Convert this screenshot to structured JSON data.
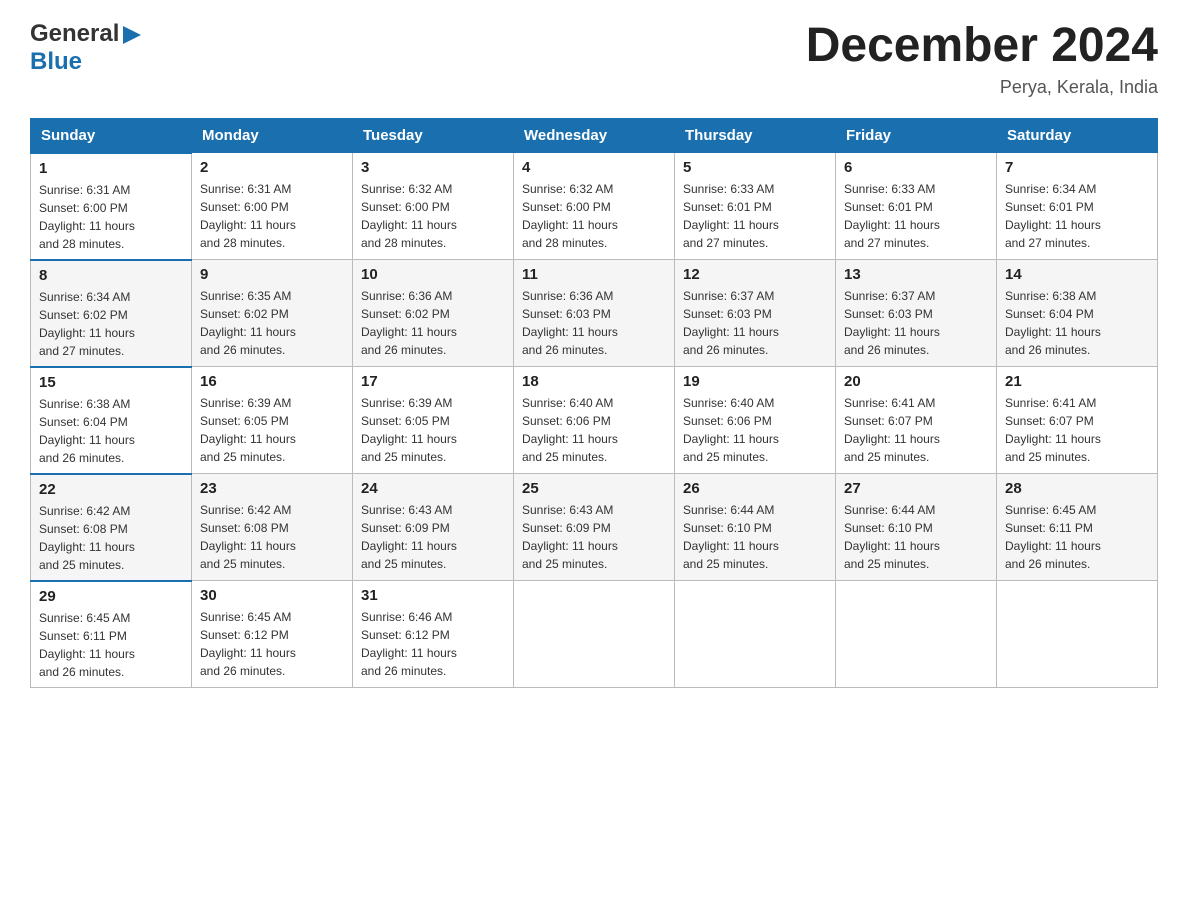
{
  "header": {
    "logo_line1": "General",
    "logo_line2": "Blue",
    "title": "December 2024",
    "subtitle": "Perya, Kerala, India"
  },
  "days_of_week": [
    "Sunday",
    "Monday",
    "Tuesday",
    "Wednesday",
    "Thursday",
    "Friday",
    "Saturday"
  ],
  "weeks": [
    [
      {
        "num": "1",
        "sunrise": "6:31 AM",
        "sunset": "6:00 PM",
        "daylight": "11 hours and 28 minutes."
      },
      {
        "num": "2",
        "sunrise": "6:31 AM",
        "sunset": "6:00 PM",
        "daylight": "11 hours and 28 minutes."
      },
      {
        "num": "3",
        "sunrise": "6:32 AM",
        "sunset": "6:00 PM",
        "daylight": "11 hours and 28 minutes."
      },
      {
        "num": "4",
        "sunrise": "6:32 AM",
        "sunset": "6:00 PM",
        "daylight": "11 hours and 28 minutes."
      },
      {
        "num": "5",
        "sunrise": "6:33 AM",
        "sunset": "6:01 PM",
        "daylight": "11 hours and 27 minutes."
      },
      {
        "num": "6",
        "sunrise": "6:33 AM",
        "sunset": "6:01 PM",
        "daylight": "11 hours and 27 minutes."
      },
      {
        "num": "7",
        "sunrise": "6:34 AM",
        "sunset": "6:01 PM",
        "daylight": "11 hours and 27 minutes."
      }
    ],
    [
      {
        "num": "8",
        "sunrise": "6:34 AM",
        "sunset": "6:02 PM",
        "daylight": "11 hours and 27 minutes."
      },
      {
        "num": "9",
        "sunrise": "6:35 AM",
        "sunset": "6:02 PM",
        "daylight": "11 hours and 26 minutes."
      },
      {
        "num": "10",
        "sunrise": "6:36 AM",
        "sunset": "6:02 PM",
        "daylight": "11 hours and 26 minutes."
      },
      {
        "num": "11",
        "sunrise": "6:36 AM",
        "sunset": "6:03 PM",
        "daylight": "11 hours and 26 minutes."
      },
      {
        "num": "12",
        "sunrise": "6:37 AM",
        "sunset": "6:03 PM",
        "daylight": "11 hours and 26 minutes."
      },
      {
        "num": "13",
        "sunrise": "6:37 AM",
        "sunset": "6:03 PM",
        "daylight": "11 hours and 26 minutes."
      },
      {
        "num": "14",
        "sunrise": "6:38 AM",
        "sunset": "6:04 PM",
        "daylight": "11 hours and 26 minutes."
      }
    ],
    [
      {
        "num": "15",
        "sunrise": "6:38 AM",
        "sunset": "6:04 PM",
        "daylight": "11 hours and 26 minutes."
      },
      {
        "num": "16",
        "sunrise": "6:39 AM",
        "sunset": "6:05 PM",
        "daylight": "11 hours and 25 minutes."
      },
      {
        "num": "17",
        "sunrise": "6:39 AM",
        "sunset": "6:05 PM",
        "daylight": "11 hours and 25 minutes."
      },
      {
        "num": "18",
        "sunrise": "6:40 AM",
        "sunset": "6:06 PM",
        "daylight": "11 hours and 25 minutes."
      },
      {
        "num": "19",
        "sunrise": "6:40 AM",
        "sunset": "6:06 PM",
        "daylight": "11 hours and 25 minutes."
      },
      {
        "num": "20",
        "sunrise": "6:41 AM",
        "sunset": "6:07 PM",
        "daylight": "11 hours and 25 minutes."
      },
      {
        "num": "21",
        "sunrise": "6:41 AM",
        "sunset": "6:07 PM",
        "daylight": "11 hours and 25 minutes."
      }
    ],
    [
      {
        "num": "22",
        "sunrise": "6:42 AM",
        "sunset": "6:08 PM",
        "daylight": "11 hours and 25 minutes."
      },
      {
        "num": "23",
        "sunrise": "6:42 AM",
        "sunset": "6:08 PM",
        "daylight": "11 hours and 25 minutes."
      },
      {
        "num": "24",
        "sunrise": "6:43 AM",
        "sunset": "6:09 PM",
        "daylight": "11 hours and 25 minutes."
      },
      {
        "num": "25",
        "sunrise": "6:43 AM",
        "sunset": "6:09 PM",
        "daylight": "11 hours and 25 minutes."
      },
      {
        "num": "26",
        "sunrise": "6:44 AM",
        "sunset": "6:10 PM",
        "daylight": "11 hours and 25 minutes."
      },
      {
        "num": "27",
        "sunrise": "6:44 AM",
        "sunset": "6:10 PM",
        "daylight": "11 hours and 25 minutes."
      },
      {
        "num": "28",
        "sunrise": "6:45 AM",
        "sunset": "6:11 PM",
        "daylight": "11 hours and 26 minutes."
      }
    ],
    [
      {
        "num": "29",
        "sunrise": "6:45 AM",
        "sunset": "6:11 PM",
        "daylight": "11 hours and 26 minutes."
      },
      {
        "num": "30",
        "sunrise": "6:45 AM",
        "sunset": "6:12 PM",
        "daylight": "11 hours and 26 minutes."
      },
      {
        "num": "31",
        "sunrise": "6:46 AM",
        "sunset": "6:12 PM",
        "daylight": "11 hours and 26 minutes."
      },
      null,
      null,
      null,
      null
    ]
  ],
  "labels": {
    "sunrise": "Sunrise:",
    "sunset": "Sunset:",
    "daylight": "Daylight:"
  },
  "colors": {
    "header_bg": "#1a6faf",
    "header_text": "#ffffff",
    "logo_blue": "#1a6faf"
  }
}
